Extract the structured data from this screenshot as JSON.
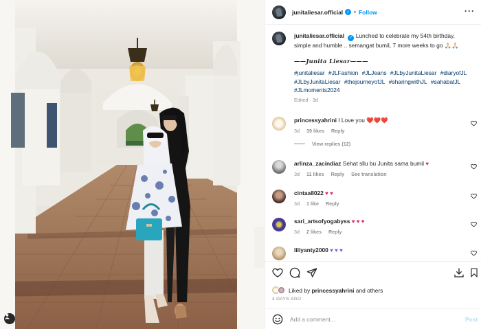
{
  "post": {
    "username": "junitaliesar.official",
    "follow_label": "Follow",
    "separator": "•",
    "more_label": "···"
  },
  "caption": {
    "username": "junitaliesar.official",
    "text": "Lunched to celebrate my 54th birthday, simple and humble .. semangat bumil, 7 more weeks to go 🙏🏻🙏🏻",
    "signature": "——Junita Liesar———",
    "hashtags": [
      "#junitaliesar",
      "#JLFashion",
      "#JLJeans",
      "#JLbyJunitaLiesar",
      "#diaryofJL",
      "#JLbyJunitaLiesar",
      "#thejourneyofJL",
      "#sharingwithJL",
      "#sahabatJL",
      "#JLmoments2024"
    ],
    "meta": "Edited · 3d"
  },
  "comments": [
    {
      "username": "princessyahrini",
      "text": "I Love you ❤️❤️❤️",
      "age": "3d",
      "likes": "39 likes",
      "reply": "Reply",
      "view_replies": "View replies (12)",
      "avatar_color": "#f3e3cf"
    },
    {
      "username": "arlinza_zacindiaz",
      "text": "Sehat sllu bu Junita sama bumil ",
      "emoji": "♥",
      "age": "3d",
      "likes": "11 likes",
      "reply": "Reply",
      "translation": "See translation",
      "avatar_color": "#7f7f7f"
    },
    {
      "username": "cintaa8022",
      "text": "",
      "emoji": "♥ ♥",
      "age": "3d",
      "likes": "1 like",
      "reply": "Reply",
      "avatar_color": "#5a3d33"
    },
    {
      "username": "sari_artsofyogabyss",
      "text": "",
      "emoji": "♥ ♥ ♥",
      "age": "3d",
      "likes": "2 likes",
      "reply": "Reply",
      "avatar_color": "#2c3b8f"
    },
    {
      "username": "liliyanty2000",
      "text": "",
      "emoji": "♥ ♥ ♥",
      "avatar_color": "#c9b08d"
    }
  ],
  "likes": {
    "prefix": "Liked by ",
    "user": "princessyahrini",
    "suffix": " and others",
    "time_ago": "4 DAYS AGO"
  },
  "add_comment": {
    "placeholder": "Add a comment...",
    "post_label": "Post"
  },
  "colors": {
    "link": "#0095f6",
    "hashtag": "#00376b",
    "heart": "#ed4956",
    "muted": "#8e8e8e"
  },
  "icons": [
    "heart-icon",
    "comment-icon",
    "share-icon",
    "save-icon",
    "download-icon",
    "emoji-icon",
    "user-tag-icon",
    "verified-icon"
  ]
}
